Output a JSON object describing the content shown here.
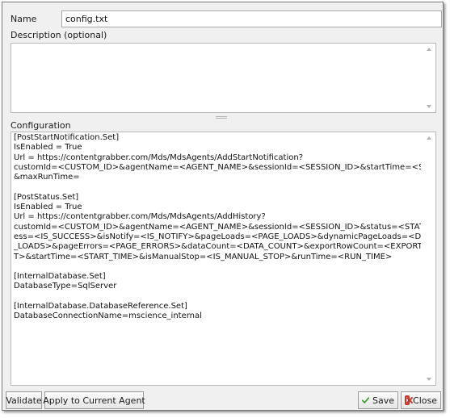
{
  "form": {
    "name_label": "Name",
    "name_value": "config.txt",
    "description_label": "Description (optional)",
    "description_value": "",
    "configuration_label": "Configuration",
    "configuration_text": "[PostStartNotification.Set]\nIsEnabled = True\nUrl = https://contentgrabber.com/Mds/MdsAgents/AddStartNotification?\ncustomId=<CUSTOM_ID>&agentName=<AGENT_NAME>&sessionId=<SESSION_ID>&startTime=<START_TIME>\n&maxRunTime=\n\n[PostStatus.Set]\nIsEnabled = True\nUrl = https://contentgrabber.com/Mds/MdsAgents/AddHistory?\ncustomId=<CUSTOM_ID>&agentName=<AGENT_NAME>&sessionId=<SESSION_ID>&status=<STATUS>&isSucc\ness=<IS_SUCCESS>&isNotify=<IS_NOTIFY>&pageLoads=<PAGE_LOADS>&dynamicPageLoads=<DYNAMIC_PAGE\n_LOADS>&pageErrors=<PAGE_ERRORS>&dataCount=<DATA_COUNT>&exportRowCount=<EXPORT_ROW_COUN\nT>&startTime=<START_TIME>&isManualStop=<IS_MANUAL_STOP>&runTime=<RUN_TIME>\n\n[InternalDatabase.Set]\nDatabaseType=SqlServer\n\n[InternalDatabase.DatabaseReference.Set]\nDatabaseConnectionName=mscience_internal"
  },
  "buttons": {
    "validate": "Validate",
    "apply": "Apply to Current Agent",
    "save": "Save",
    "close": "Close"
  },
  "icons": {
    "save": "green-check-icon",
    "close": "red-close-icon"
  },
  "colors": {
    "save_icon": "#3a9a2e",
    "close_icon": "#c0392b"
  }
}
